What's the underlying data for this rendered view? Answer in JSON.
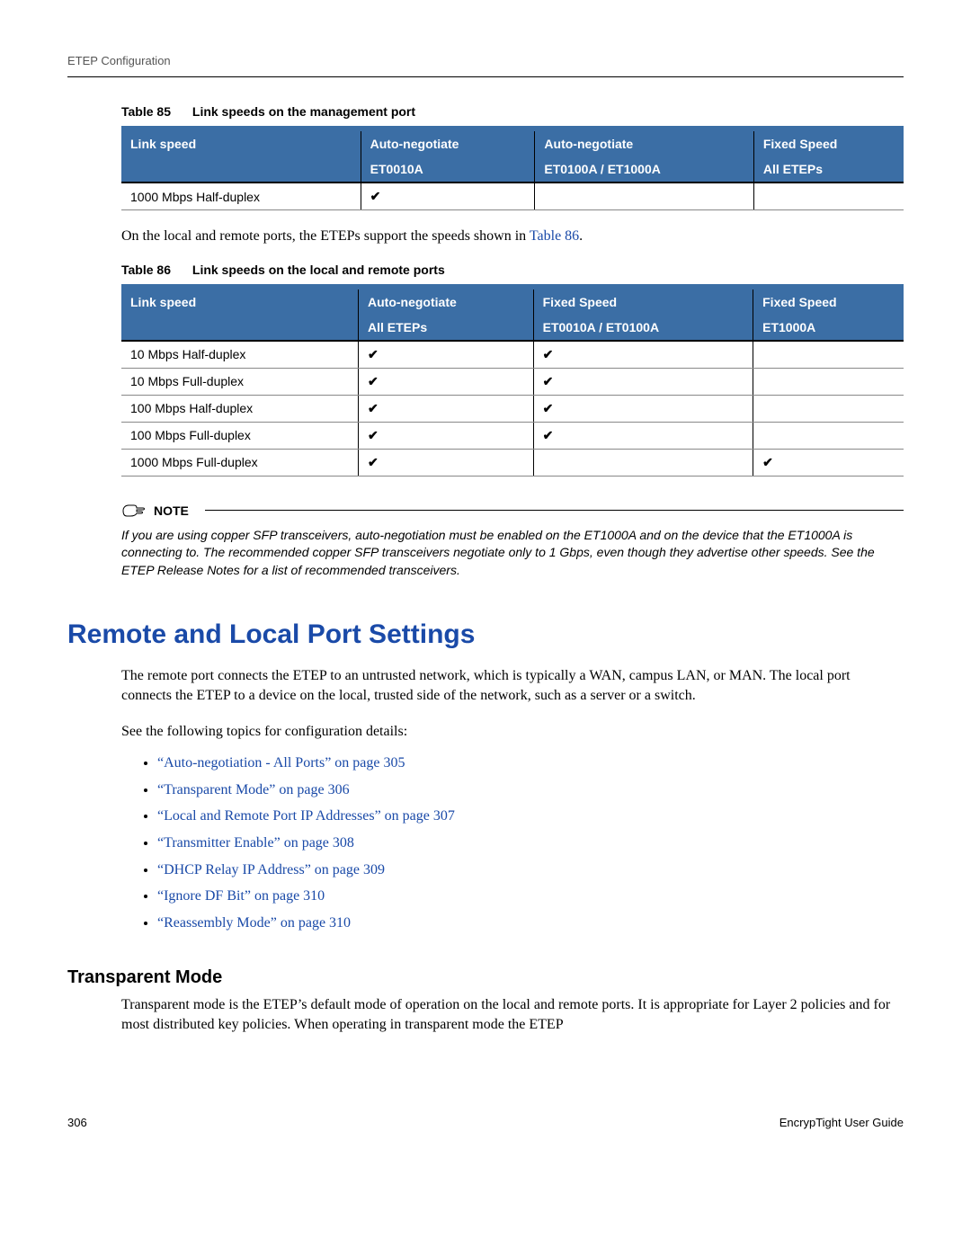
{
  "header": "ETEP Configuration",
  "table85": {
    "label": "Table 85",
    "title": "Link speeds on the management port",
    "headers_r1": [
      "Link speed",
      "Auto-negotiate",
      "Auto-negotiate",
      "Fixed Speed"
    ],
    "headers_r2": [
      "",
      "ET0010A",
      "ET0100A / ET1000A",
      "All ETEPs"
    ],
    "rows": [
      {
        "speed": "1000 Mbps Half-duplex",
        "c1": "✔",
        "c2": "",
        "c3": ""
      }
    ]
  },
  "para_between": "On the local and remote ports, the ETEPs support the speeds shown in ",
  "para_between_link": "Table 86",
  "para_between_end": ".",
  "table86": {
    "label": "Table 86",
    "title": "Link speeds on the local and remote ports",
    "headers_r1": [
      "Link speed",
      "Auto-negotiate",
      "Fixed Speed",
      "Fixed Speed"
    ],
    "headers_r2": [
      "",
      "All ETEPs",
      "ET0010A / ET0100A",
      "ET1000A"
    ],
    "rows": [
      {
        "speed": "10 Mbps Half-duplex",
        "c1": "✔",
        "c2": "✔",
        "c3": ""
      },
      {
        "speed": "10 Mbps Full-duplex",
        "c1": "✔",
        "c2": "✔",
        "c3": ""
      },
      {
        "speed": "100 Mbps Half-duplex",
        "c1": "✔",
        "c2": "✔",
        "c3": ""
      },
      {
        "speed": "100 Mbps Full-duplex",
        "c1": "✔",
        "c2": "✔",
        "c3": ""
      },
      {
        "speed": "1000 Mbps Full-duplex",
        "c1": "✔",
        "c2": "",
        "c3": "✔"
      }
    ]
  },
  "note": {
    "label": "NOTE",
    "text": "If you are using copper SFP transceivers, auto-negotiation must be enabled on the ET1000A and on the device that the ET1000A is connecting to. The recommended copper SFP transceivers negotiate only to 1 Gbps, even though they advertise other speeds. See the ETEP Release Notes for a list of recommended transceivers."
  },
  "section_title": "Remote and Local Port Settings",
  "section_p1": "The remote port connects the ETEP to an untrusted network, which is typically a WAN, campus LAN, or MAN. The local port connects the ETEP to a device on the local, trusted side of the network, such as a server or a switch.",
  "section_p2": "See the following topics for configuration details:",
  "links": [
    "“Auto-negotiation - All Ports” on page 305",
    "“Transparent Mode” on page 306",
    "“Local and Remote Port IP Addresses” on page 307",
    "“Transmitter Enable” on page 308",
    "“DHCP Relay IP Address” on page 309",
    "“Ignore DF Bit” on page 310",
    "“Reassembly Mode” on page 310"
  ],
  "subsection_title": "Transparent Mode",
  "subsection_p1": "Transparent mode is the ETEP’s default mode of operation on the local and remote ports. It is appropriate for Layer 2 policies and for most distributed key policies. When operating in transparent mode the ETEP",
  "footer": {
    "page": "306",
    "doc": "EncrypTight User Guide"
  }
}
